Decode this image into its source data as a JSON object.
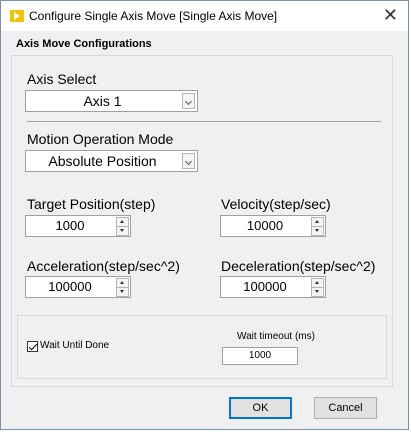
{
  "window": {
    "title": "Configure Single Axis Move [Single Axis Move]"
  },
  "section": {
    "title": "Axis Move Configurations"
  },
  "axis_select": {
    "label": "Axis Select",
    "value": "Axis 1"
  },
  "motion_mode": {
    "label": "Motion Operation Mode",
    "value": "Absolute Position"
  },
  "target_position": {
    "label": "Target Position(step)",
    "value": "1000"
  },
  "velocity": {
    "label": "Velocity(step/sec)",
    "value": "10000"
  },
  "acceleration": {
    "label": "Acceleration(step/sec^2)",
    "value": "100000"
  },
  "deceleration": {
    "label": "Deceleration(step/sec^2)",
    "value": "100000"
  },
  "wait_until_done": {
    "label": "Wait Until Done",
    "checked": true
  },
  "wait_timeout": {
    "label": "Wait timeout (ms)",
    "value": "1000"
  },
  "buttons": {
    "ok": "OK",
    "cancel": "Cancel"
  },
  "icons": {
    "app": "labview-play-icon",
    "close": "close-icon"
  },
  "colors": {
    "app_icon": "#f5c400",
    "primary_border": "#0078d7"
  }
}
